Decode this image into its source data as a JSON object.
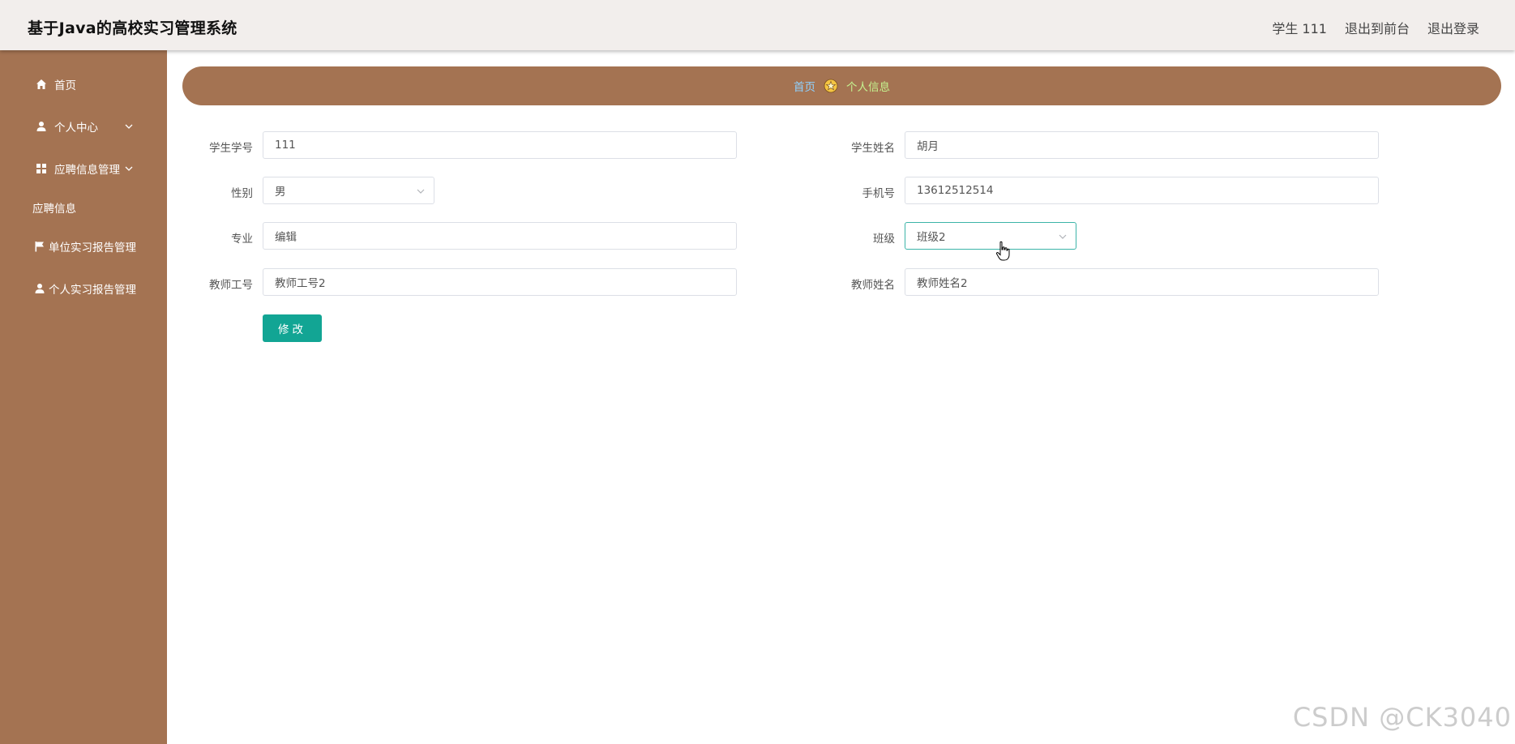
{
  "header": {
    "title": "基于Java的高校实习管理系统",
    "user_label": "学生 111",
    "to_front_label": "退出到前台",
    "logout_label": "退出登录"
  },
  "sidebar": {
    "items": [
      {
        "label": "首页",
        "icon": "home-icon"
      },
      {
        "label": "个人中心",
        "icon": "user-icon"
      },
      {
        "label": "应聘信息管理",
        "icon": "grid-icon"
      },
      {
        "label": "应聘信息"
      },
      {
        "label": "单位实习报告管理",
        "icon": "flag-icon"
      },
      {
        "label": "个人实习报告管理",
        "icon": "user-icon"
      }
    ]
  },
  "breadcrumb": {
    "home": "首页",
    "current": "个人信息"
  },
  "form": {
    "student_id": {
      "label": "学生学号",
      "value": "111"
    },
    "student_name": {
      "label": "学生姓名",
      "value": "胡月"
    },
    "gender": {
      "label": "性别",
      "value": "男"
    },
    "phone": {
      "label": "手机号",
      "value": "13612512514"
    },
    "major": {
      "label": "专业",
      "value": "编辑"
    },
    "class": {
      "label": "班级",
      "value": "班级2"
    },
    "teacher_id": {
      "label": "教师工号",
      "value": "教师工号2"
    },
    "teacher_name": {
      "label": "教师姓名",
      "value": "教师姓名2"
    },
    "submit_label": "修改"
  },
  "watermark": "CSDN @CK3040",
  "colors": {
    "sidebar": "#a47352",
    "header": "#f2eeec",
    "button": "#12a594",
    "crumb_home": "#8fd2ff",
    "crumb_current": "#c5f28f"
  }
}
